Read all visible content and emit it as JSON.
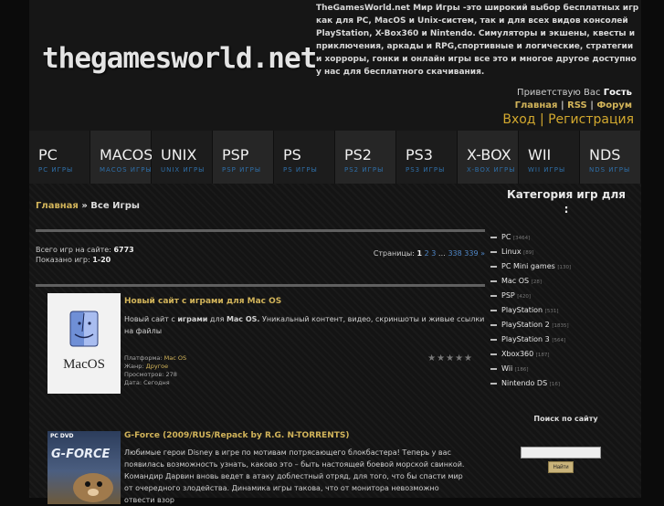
{
  "site": {
    "logo": "thegamesworld.net",
    "description": "TheGamesWorld.net Мир Игры  -это широкий выбор бесплатных игр как для PC, MacOS и Unix-систем, так и для всех видов консолей PlayStation, X-Box360 и Nintendo. Симуляторы и экшены, квесты и приключения, аркады и  RPG,спортивные и логические, стратегии и хорроры, гонки и онлайн игры   все это и многое другое доступно у нас для бесплатного скачивания.",
    "greeting": "Приветствую Вас",
    "user": "Гость",
    "links": {
      "home": "Главная",
      "rss": "RSS",
      "forum": "Форум",
      "sep": "|"
    },
    "login": "Вход",
    "register": "Регистрация",
    "auth_sep": "|"
  },
  "nav": [
    {
      "title": "PC",
      "sub": "PC ИГРЫ"
    },
    {
      "title": "MACOS",
      "sub": "MACOS ИГРЫ"
    },
    {
      "title": "UNIX",
      "sub": "UNIX ИГРЫ"
    },
    {
      "title": "PSP",
      "sub": "PSP ИГРЫ"
    },
    {
      "title": "PS",
      "sub": "PS ИГРЫ"
    },
    {
      "title": "PS2",
      "sub": "PS2 ИГРЫ"
    },
    {
      "title": "PS3",
      "sub": "PS3 ИГРЫ"
    },
    {
      "title": "X-BOX",
      "sub": "X-BOX ИГРЫ"
    },
    {
      "title": "WII",
      "sub": "WII ИГРЫ"
    },
    {
      "title": "NDS",
      "sub": "NDS ИГРЫ"
    }
  ],
  "breadcrumb": {
    "home": "Главная",
    "sep": "»",
    "current": "Все Игры"
  },
  "stats": {
    "total_label": "Всего игр на сайте:",
    "total": "6773",
    "shown_label": "Показано игр:",
    "shown": "1-20"
  },
  "pagination": {
    "label": "Страницы:",
    "current": "1",
    "p2": "2",
    "p3": "3",
    "ellipsis": "…",
    "p338": "338",
    "p339": "339",
    "next": "»"
  },
  "entries": [
    {
      "title": "Новый сайт с играми для Mac OS",
      "text_parts": [
        "Новый сайт с ",
        "играми",
        " для ",
        "Mac OS.",
        " Уникальный контент, видео, скриншоты и живые ссылки на файлы"
      ],
      "thumb_label": "MacOS",
      "platform_label": "Платформа:",
      "platform": "Mac OS",
      "genre_label": "Жанр:",
      "genre": "Другое",
      "views_label": "Просмотров:",
      "views": "278",
      "date_label": "Дата:",
      "date": "Сегодня",
      "stars": "★★★★★"
    },
    {
      "title": "G-Force (2009/RUS/Repack by R.G. N-TORRENTS)",
      "text": "Любимые герои Disney в игре по мотивам потрясающего блокбастера! Теперь у вас появилась возможность узнать, каково это – быть настоящей боевой морской свинкой. Командир Дарвин вновь ведет в атаку доблестный отряд, для того, что бы спасти мир от очередного злодейства. Динамика игры такова, что от монитора невозможно отвести взор",
      "thumb_badge": "PC DVD",
      "thumb_label": "G-FORCE"
    }
  ],
  "sidebar": {
    "category_heading": "Категория игр для",
    "category_colon": ":",
    "categories": [
      {
        "name": "PC",
        "count": "[3464]"
      },
      {
        "name": "Linux",
        "count": "[89]"
      },
      {
        "name": "PC Mini games",
        "count": "[130]"
      },
      {
        "name": "Mac OS",
        "count": "[28]"
      },
      {
        "name": "PSP",
        "count": "[420]"
      },
      {
        "name": "PlayStation",
        "count": "[531]"
      },
      {
        "name": "PlayStation 2",
        "count": "[1835]"
      },
      {
        "name": "PlayStation 3",
        "count": "[564]"
      },
      {
        "name": "Xbox360",
        "count": "[187]"
      },
      {
        "name": "Wii",
        "count": "[186]"
      },
      {
        "name": "Nintendo DS",
        "count": "[16]"
      }
    ],
    "search_heading": "Поиск по сайту",
    "search_button": "Найти"
  },
  "colors": {
    "link": "#d2b45a",
    "accent": "#d2a82e",
    "nav_sub": "#2f6fa8",
    "page_link": "#4f86c6"
  }
}
